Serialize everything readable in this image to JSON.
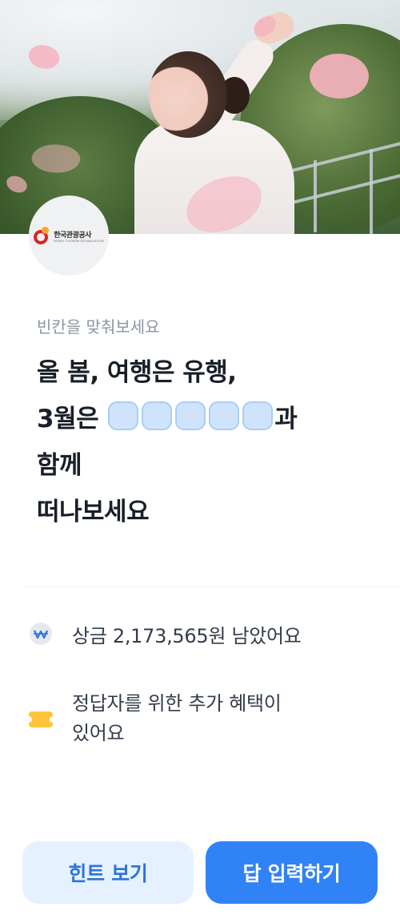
{
  "hero": {
    "image": "woman-with-flower-petals-photo"
  },
  "logo": {
    "name_ko": "한국관광공사",
    "name_en": "KOREA TOURISM ORGANIZATION"
  },
  "quiz": {
    "subtitle": "빈칸을 맞춰보세요",
    "question_lines": [
      "올 봄, 여행은 유행,",
      "3월은",
      "과",
      "함께",
      "떠나보세요"
    ],
    "blank_count": 5
  },
  "info": {
    "prize_text": "상금 2,173,565원 남았어요",
    "bonus_line1": "정답자를 위한 추가 혜택이",
    "bonus_line2": "있어요",
    "prize_icon": "won-coin-icon",
    "bonus_icon": "ticket-icon"
  },
  "buttons": {
    "hint_label": "힌트 보기",
    "answer_label": "답 입력하기"
  },
  "colors": {
    "primary": "#3182f6",
    "primary_light": "#e5f1fe",
    "blank_fill": "#cfe4fb",
    "ticket": "#ffc43c"
  }
}
